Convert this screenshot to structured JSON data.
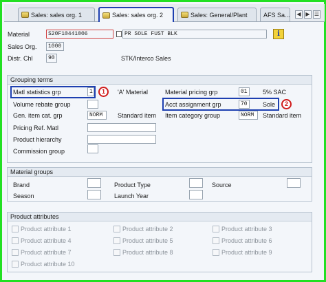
{
  "tabs": [
    {
      "label": "Sales: sales org. 1"
    },
    {
      "label": "Sales: sales org. 2"
    },
    {
      "label": "Sales: General/Plant"
    },
    {
      "label": "AFS Sa..."
    }
  ],
  "header": {
    "material_label": "Material",
    "material_value": "S20F10441006",
    "material_desc": "PR SOLE FUST BLK",
    "sales_org_label": "Sales Org.",
    "sales_org_value": "1000",
    "distr_chl_label": "Distr. Chl",
    "distr_chl_value": "90",
    "distr_chl_desc": "STK/Interco Sales"
  },
  "grouping": {
    "title": "Grouping terms",
    "matl_stat_grp_label": "Matl statistics grp",
    "matl_stat_grp_value": "1",
    "matl_stat_grp_desc": "'A' Material",
    "badge1": "1",
    "mat_pricing_grp_label": "Material pricing grp",
    "mat_pricing_grp_value": "01",
    "mat_pricing_grp_desc": "5% SAC",
    "volume_rebate_label": "Volume rebate group",
    "acct_assign_label": "Acct assignment grp",
    "acct_assign_value": "70",
    "acct_assign_desc": "Sole",
    "badge2": "2",
    "gen_item_cat_label": "Gen. item cat. grp",
    "gen_item_cat_value": "NORM",
    "gen_item_cat_desc": "Standard item",
    "item_cat_group_label": "Item category group",
    "item_cat_group_value": "NORM",
    "item_cat_group_desc": "Standard item",
    "pricing_ref_label": "Pricing Ref. Matl",
    "product_hierarchy_label": "Product hierarchy",
    "commission_label": "Commission group"
  },
  "material_groups": {
    "title": "Material groups",
    "brand": "Brand",
    "product_type": "Product Type",
    "source": "Source",
    "season": "Season",
    "launch_year": "Launch Year"
  },
  "product_attributes": {
    "title": "Product attributes",
    "items": [
      "Product attribute 1",
      "Product attribute 2",
      "Product attribute 3",
      "Product attribute 4",
      "Product attribute 5",
      "Product attribute 6",
      "Product attribute 7",
      "Product attribute 8",
      "Product attribute 9",
      "Product attribute 10"
    ]
  },
  "colors": {
    "frame": "#22e022",
    "highlight": "#1d3fb0",
    "badge": "#d01a1a"
  },
  "icons": {
    "tab_icon": "sales-tab-icon",
    "info": "info-icon",
    "prev": "tab-scroll-left-icon",
    "next": "tab-scroll-right-icon",
    "menu": "tab-list-icon",
    "desc": "long-text-icon"
  }
}
